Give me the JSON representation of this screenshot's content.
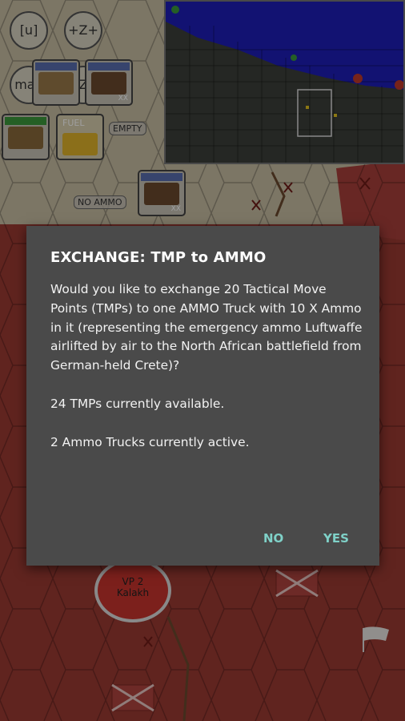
{
  "map_controls": {
    "undo_label": "[u]",
    "zoom_in_label": "+Z+",
    "map_label": "map",
    "zoom_out_label": "-Z-"
  },
  "map_tags": {
    "fuel_label": "FUEL",
    "empty_label": "EMPTY",
    "no_ammo_label": "NO AMMO",
    "unit_xx_label": "XX"
  },
  "map_markers": {
    "victory_point": "VP 2",
    "victory_place": "Kalakh"
  },
  "dialog": {
    "title": "EXCHANGE: TMP to AMMO",
    "message": "Would you like to exchange 20 Tactical Move Points (TMPs) to one AMMO Truck with 10 X Ammo in it (representing the emergency ammo Luftwaffe airlifted by air to the North African battlefield from German-held Crete)?",
    "tmp_status": "24 TMPs currently available.",
    "truck_status": "2 Ammo Trucks currently active.",
    "no_label": "NO",
    "yes_label": "YES"
  },
  "colors": {
    "accent": "#7fd1c8",
    "dialog_bg": "#4a4a4a",
    "allied_hex": "#8a2f2a",
    "sea": "#1d1db8"
  }
}
